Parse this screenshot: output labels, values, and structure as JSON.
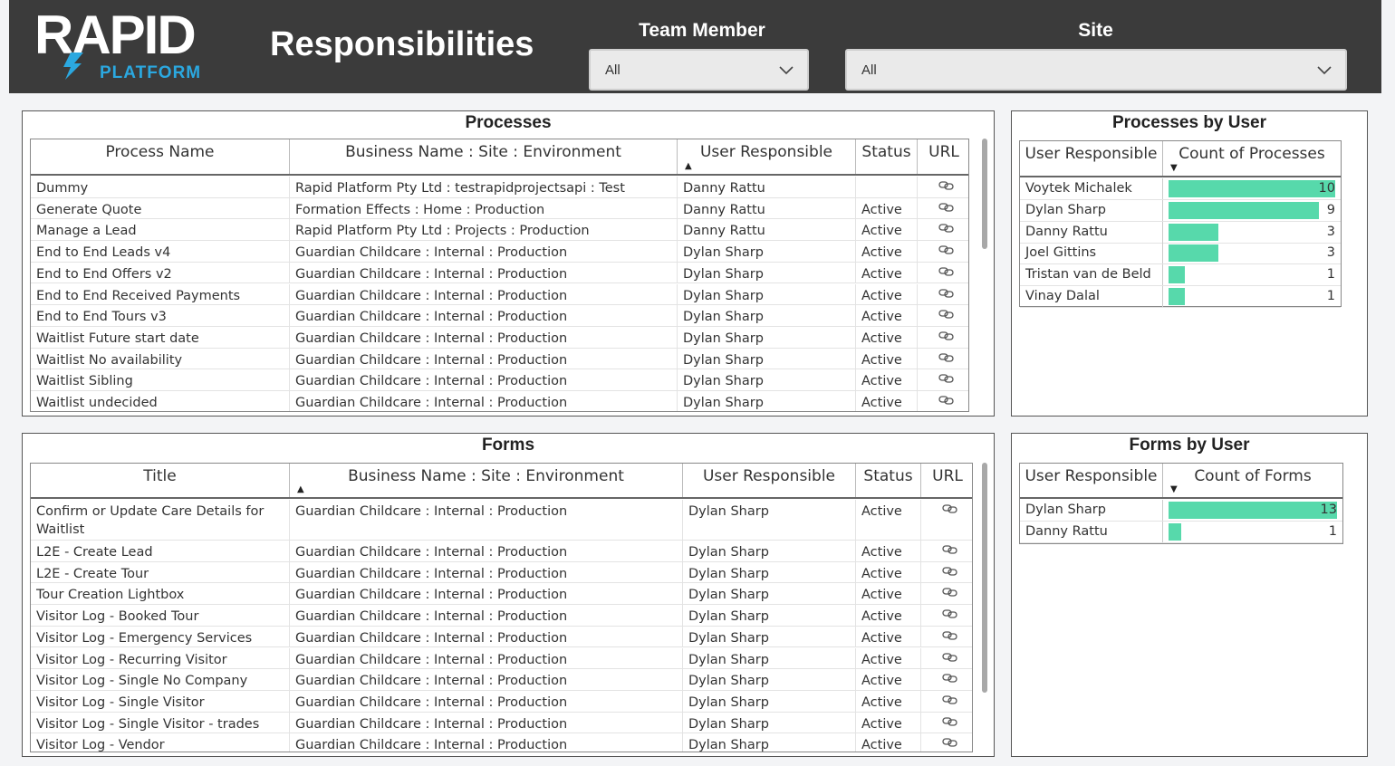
{
  "header": {
    "logo_text": "RAPID",
    "logo_sub": "PLATFORM",
    "title": "Responsibilities",
    "team_member": {
      "label": "Team Member",
      "value": "All"
    },
    "site": {
      "label": "Site",
      "value": "All"
    }
  },
  "colors": {
    "header_bg": "#3b3b3b",
    "bar": "#57d9ab",
    "logo_accent": "#2ba8e0"
  },
  "processes": {
    "title": "Processes",
    "columns": [
      "Process Name",
      "Business Name : Site : Environment",
      "User Responsible",
      "Status",
      "URL"
    ],
    "sorted_column": "User Responsible",
    "rows": [
      [
        "Dummy",
        "Rapid Platform Pty Ltd : testrapidprojectsapi : Test",
        "Danny Rattu",
        "",
        "link-icon"
      ],
      [
        "Generate Quote",
        "Formation Effects : Home : Production",
        "Danny Rattu",
        "Active",
        "link-icon"
      ],
      [
        "Manage a Lead",
        "Rapid Platform Pty Ltd : Projects : Production",
        "Danny Rattu",
        "Active",
        "link-icon"
      ],
      [
        "End to End Leads v4",
        "Guardian Childcare : Internal : Production",
        "Dylan Sharp",
        "Active",
        "link-icon"
      ],
      [
        "End to End Offers v2",
        "Guardian Childcare : Internal : Production",
        "Dylan Sharp",
        "Active",
        "link-icon"
      ],
      [
        "End to End Received Payments",
        "Guardian Childcare : Internal : Production",
        "Dylan Sharp",
        "Active",
        "link-icon"
      ],
      [
        "End to End Tours v3",
        "Guardian Childcare : Internal : Production",
        "Dylan Sharp",
        "Active",
        "link-icon"
      ],
      [
        "Waitlist Future start date",
        "Guardian Childcare : Internal : Production",
        "Dylan Sharp",
        "Active",
        "link-icon"
      ],
      [
        "Waitlist No availability",
        "Guardian Childcare : Internal : Production",
        "Dylan Sharp",
        "Active",
        "link-icon"
      ],
      [
        "Waitlist Sibling",
        "Guardian Childcare : Internal : Production",
        "Dylan Sharp",
        "Active",
        "link-icon"
      ],
      [
        "Waitlist undecided",
        "Guardian Childcare : Internal : Production",
        "Dylan Sharp",
        "Active",
        "link-icon"
      ]
    ]
  },
  "forms": {
    "title": "Forms",
    "columns": [
      "Title",
      "Business Name : Site : Environment",
      "User Responsible",
      "Status",
      "URL"
    ],
    "sorted_column": "Title",
    "rows": [
      [
        "Confirm or Update Care Details for Waitlist",
        "Guardian Childcare : Internal : Production",
        "Dylan Sharp",
        "Active",
        "link-icon"
      ],
      [
        "L2E - Create Lead",
        "Guardian Childcare : Internal : Production",
        "Dylan Sharp",
        "Active",
        "link-icon"
      ],
      [
        "L2E - Create Tour",
        "Guardian Childcare : Internal : Production",
        "Dylan Sharp",
        "Active",
        "link-icon"
      ],
      [
        "Tour Creation Lightbox",
        "Guardian Childcare : Internal : Production",
        "Dylan Sharp",
        "Active",
        "link-icon"
      ],
      [
        "Visitor Log - Booked Tour",
        "Guardian Childcare : Internal : Production",
        "Dylan Sharp",
        "Active",
        "link-icon"
      ],
      [
        "Visitor Log - Emergency Services",
        "Guardian Childcare : Internal : Production",
        "Dylan Sharp",
        "Active",
        "link-icon"
      ],
      [
        "Visitor Log - Recurring Visitor",
        "Guardian Childcare : Internal : Production",
        "Dylan Sharp",
        "Active",
        "link-icon"
      ],
      [
        "Visitor Log - Single No Company",
        "Guardian Childcare : Internal : Production",
        "Dylan Sharp",
        "Active",
        "link-icon"
      ],
      [
        "Visitor Log - Single Visitor",
        "Guardian Childcare : Internal : Production",
        "Dylan Sharp",
        "Active",
        "link-icon"
      ],
      [
        "Visitor Log - Single Visitor - trades",
        "Guardian Childcare : Internal : Production",
        "Dylan Sharp",
        "Active",
        "link-icon"
      ],
      [
        "Visitor Log - Vendor",
        "Guardian Childcare : Internal : Production",
        "Dylan Sharp",
        "Active",
        "link-icon"
      ]
    ]
  },
  "processes_by_user": {
    "title": "Processes by User",
    "columns": [
      "User Responsible",
      "Count of Processes"
    ],
    "max": 10,
    "rows": [
      {
        "name": "Voytek Michalek",
        "value": 10
      },
      {
        "name": "Dylan Sharp",
        "value": 9
      },
      {
        "name": "Danny Rattu",
        "value": 3
      },
      {
        "name": "Joel Gittins",
        "value": 3
      },
      {
        "name": "Tristan van de Beld",
        "value": 1
      },
      {
        "name": "Vinay Dalal",
        "value": 1
      }
    ]
  },
  "forms_by_user": {
    "title": "Forms by User",
    "columns": [
      "User Responsible",
      "Count of Forms"
    ],
    "max": 13,
    "rows": [
      {
        "name": "Dylan Sharp",
        "value": 13
      },
      {
        "name": "Danny Rattu",
        "value": 1
      }
    ]
  }
}
